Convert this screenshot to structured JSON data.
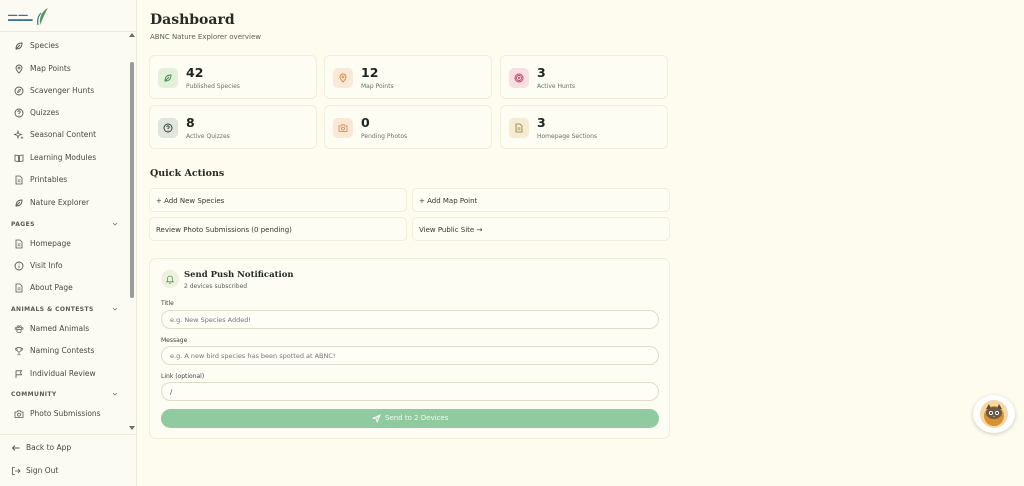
{
  "colors": {
    "background": "#fdfcee",
    "accent_green": "#8fcb9f",
    "brand_blue": "#3c6f8f"
  },
  "logo": {
    "icon": "leaf-logo-icon"
  },
  "sidebar": {
    "items_top": [
      {
        "label": "Species",
        "icon": "leaf-icon"
      },
      {
        "label": "Map Points",
        "icon": "map-pin-icon"
      },
      {
        "label": "Scavenger Hunts",
        "icon": "compass-icon"
      },
      {
        "label": "Quizzes",
        "icon": "help-circle-icon"
      },
      {
        "label": "Seasonal Content",
        "icon": "sparkle-icon"
      },
      {
        "label": "Learning Modules",
        "icon": "book-open-icon"
      },
      {
        "label": "Printables",
        "icon": "file-text-icon"
      },
      {
        "label": "Nature Explorer",
        "icon": "leaf-icon"
      }
    ],
    "sections": [
      {
        "title": "PAGES",
        "items": [
          {
            "label": "Homepage",
            "icon": "file-icon"
          },
          {
            "label": "Visit Info",
            "icon": "info-icon"
          },
          {
            "label": "About Page",
            "icon": "file-text-icon"
          }
        ]
      },
      {
        "title": "ANIMALS & CONTESTS",
        "items": [
          {
            "label": "Named Animals",
            "icon": "paw-icon"
          },
          {
            "label": "Naming Contests",
            "icon": "trophy-icon"
          },
          {
            "label": "Individual Review",
            "icon": "flag-icon"
          }
        ]
      },
      {
        "title": "COMMUNITY",
        "items": [
          {
            "label": "Photo Submissions",
            "icon": "camera-icon"
          }
        ]
      }
    ],
    "back": "Back to App",
    "signout": "Sign Out"
  },
  "header": {
    "title": "Dashboard",
    "subtitle": "ABNC Nature Explorer overview"
  },
  "stats": [
    {
      "value": "42",
      "label": "Published Species",
      "icon": "leaf-icon",
      "color": "#e3f0dc"
    },
    {
      "value": "12",
      "label": "Map Points",
      "icon": "map-pin-icon",
      "color": "#fbe9d7"
    },
    {
      "value": "3",
      "label": "Active Hunts",
      "icon": "target-icon",
      "color": "#f8dfe3"
    },
    {
      "value": "8",
      "label": "Active Quizzes",
      "icon": "help-circle-icon",
      "color": "#e1e6dd"
    },
    {
      "value": "0",
      "label": "Pending Photos",
      "icon": "camera-icon",
      "color": "#fbe7d6"
    },
    {
      "value": "3",
      "label": "Homepage Sections",
      "icon": "file-text-icon",
      "color": "#f6ecd3"
    }
  ],
  "quick_actions": {
    "title": "Quick Actions",
    "items": [
      "+ Add New Species",
      "+ Add Map Point",
      "Review Photo Submissions (0 pending)",
      "View Public Site →"
    ]
  },
  "push": {
    "title": "Send Push Notification",
    "subtitle": "2 devices subscribed",
    "title_label": "Title",
    "title_placeholder": "e.g. New Species Added!",
    "message_label": "Message",
    "message_placeholder": "e.g. A new bird species has been spotted at ABNC!",
    "link_label": "Link (optional)",
    "link_value": "/",
    "send_label": "Send to 2 Devices"
  }
}
